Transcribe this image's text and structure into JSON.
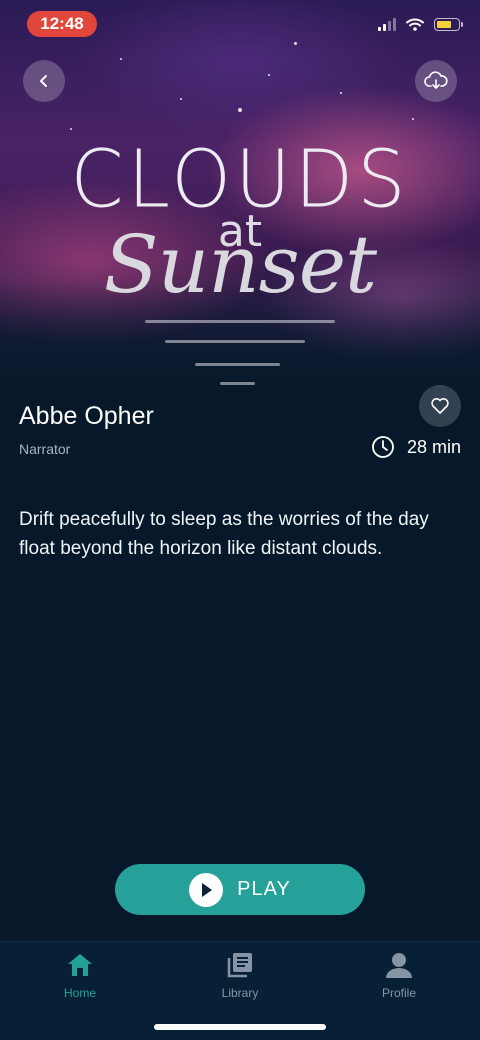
{
  "status_bar": {
    "time": "12:48"
  },
  "hero": {
    "title_line1": "CLOUDS",
    "title_line2": "at",
    "title_line3": "Sunset"
  },
  "story": {
    "narrator_name": "Abbe Opher",
    "narrator_role": "Narrator",
    "duration": "28 min",
    "description": "Drift peacefully to sleep as the worries of the day float beyond the horizon like distant clouds."
  },
  "actions": {
    "play_label": "PLAY"
  },
  "tabs": [
    {
      "label": "Home",
      "icon": "home-icon",
      "active": true
    },
    {
      "label": "Library",
      "icon": "library-icon",
      "active": false
    },
    {
      "label": "Profile",
      "icon": "profile-icon",
      "active": false
    }
  ],
  "colors": {
    "accent": "#25a199",
    "background": "#061829",
    "time_badge": "#e0463b"
  }
}
